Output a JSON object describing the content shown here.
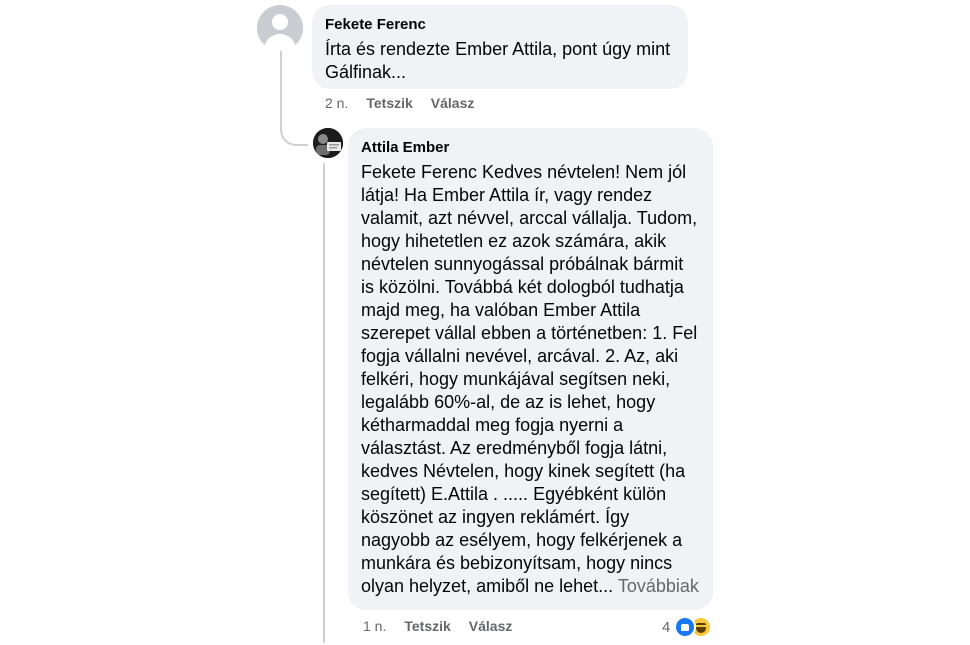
{
  "comments": [
    {
      "author": "Fekete Ferenc",
      "lines": [
        "Írta és rendezte Ember Attila, pont úgy mint",
        "Gálfinak..."
      ],
      "time": "2 n.",
      "like_label": "Tetszik",
      "reply_label": "Válasz"
    },
    {
      "author": "Attila Ember",
      "lines": [
        "Fekete Ferenc Kedves névtelen! Nem jól",
        "látja! Ha Ember Attila ír, vagy rendez",
        "valamit, azt névvel, arccal vállalja. Tudom,",
        "hogy hihetetlen ez azok számára, akik",
        "névtelen sunnyogással próbálnak bármit",
        "is közölni. Továbbá két dologból tudhatja",
        "majd meg, ha valóban Ember Attila",
        "szerepet vállal ebben a történetben: 1. Fel",
        "fogja vállalni nevével, arcával. 2. Az, aki",
        "felkéri, hogy munkájával segítsen neki,",
        "legalább 60%-al, de az is lehet, hogy",
        "kétharmaddal meg fogja nyerni a",
        "választást. Az eredményből fogja látni,",
        "kedves Névtelen, hogy kinek segített (ha",
        "segített) E.Attila . ..... Egyébként külön",
        "köszönet az ingyen reklámért. Így",
        "nagyobb az esélyem, hogy felkérjenek a",
        "munkára és bebizonyítsam, hogy nincs",
        "olyan helyzet, amiből ne lehet..."
      ],
      "see_more": "Továbbiak",
      "time": "1 n.",
      "like_label": "Tetszik",
      "reply_label": "Válasz",
      "reaction_count": "4",
      "reaction_icons": [
        "like-icon",
        "haha-icon"
      ]
    }
  ],
  "colors": {
    "bubble": "#f0f2f5",
    "meta_text": "#65676b",
    "like_blue": "#1877f2",
    "haha_yellow": "#f7c83a"
  }
}
